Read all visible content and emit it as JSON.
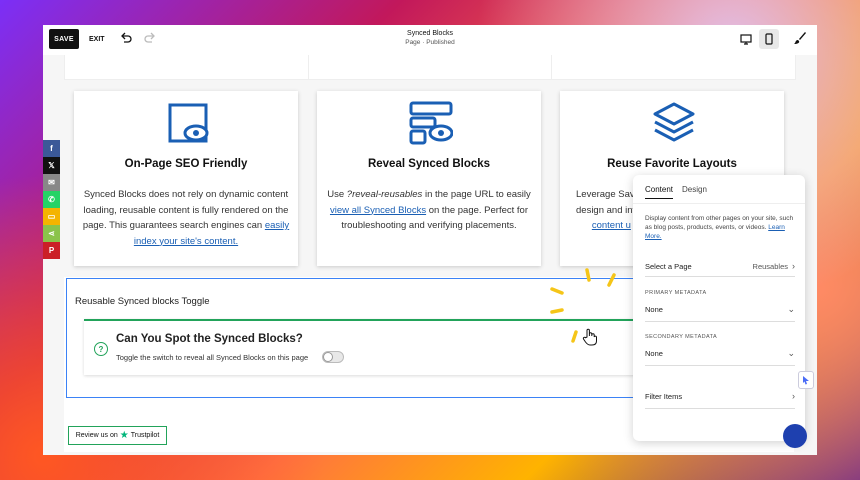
{
  "toolbar": {
    "save_label": "SAVE",
    "exit_label": "EXIT",
    "title": "Synced Blocks",
    "subtitle": "Page · Published"
  },
  "cards": [
    {
      "title": "On-Page SEO Friendly",
      "text_before": "Synced Blocks does not rely on dynamic content loading, reusable content is fully rendered on the page. This guarantees search engines can ",
      "link": "easily index your site's content.",
      "text_after": "",
      "icon": "seo-eye-icon"
    },
    {
      "title": "Reveal Synced Blocks",
      "text_before": "Use ",
      "em": "?reveal-reusables",
      "text_mid": " in the page URL to easily ",
      "link": "view all Synced Blocks",
      "text_after": " on the page. Perfect for troubleshooting and verifying placements.",
      "icon": "reveal-layout-eye-icon"
    },
    {
      "title": "Reuse Favorite Layouts",
      "text_before": "Leverage Sav",
      "text_line2": "design and inte",
      "link": "content u",
      "icon": "layers-icon"
    }
  ],
  "toggle_section": {
    "title": "Reusable Synced blocks Toggle",
    "card_title": "Can You Spot the Synced Blocks?",
    "card_desc": "Toggle the switch to reveal all Synced Blocks on this page",
    "switch_on": false
  },
  "trustpilot": {
    "prefix": "Review us on",
    "brand": "Trustpilot"
  },
  "social": [
    {
      "icon": "facebook-icon",
      "glyph": "f",
      "color": "#3b5998"
    },
    {
      "icon": "x-icon",
      "glyph": "𝕏",
      "color": "#111111"
    },
    {
      "icon": "email-icon",
      "glyph": "✉",
      "color": "#888888"
    },
    {
      "icon": "whatsapp-icon",
      "glyph": "✆",
      "color": "#25d366"
    },
    {
      "icon": "sms-icon",
      "glyph": "▭",
      "color": "#f4b400"
    },
    {
      "icon": "share-icon",
      "glyph": "⋖",
      "color": "#8bc34a"
    },
    {
      "icon": "pinterest-icon",
      "glyph": "P",
      "color": "#cb2027"
    }
  ],
  "panel": {
    "tab_content": "Content",
    "tab_design": "Design",
    "description": "Display content from other pages on your site, such as blog posts, products, events, or videos.",
    "learn_more": "Learn More.",
    "select_page_label": "Select a Page",
    "select_page_value": "Reusables",
    "primary_label": "PRIMARY METADATA",
    "primary_value": "None",
    "secondary_label": "SECONDARY METADATA",
    "secondary_value": "None",
    "filter_label": "Filter Items"
  },
  "colors": {
    "accent_blue": "#1a5fb4",
    "green": "#22a35a",
    "selection_blue": "#3b82f6",
    "spark_yellow": "#f5c518"
  }
}
